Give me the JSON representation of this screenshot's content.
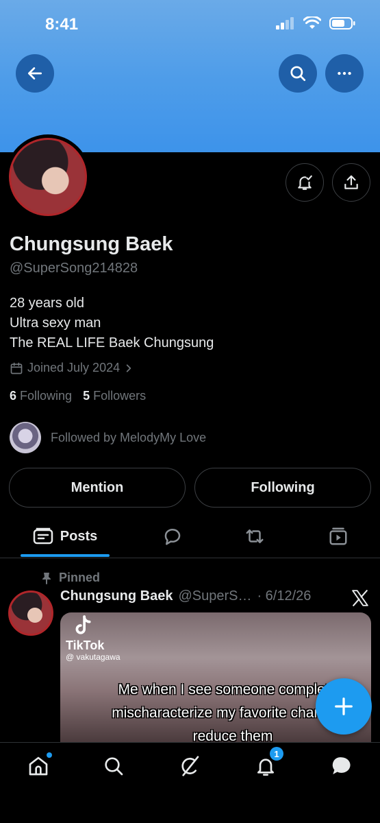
{
  "status_bar": {
    "time": "8:41"
  },
  "profile": {
    "name": "Chungsung Baek",
    "handle": "@SuperSong214828",
    "bio": [
      "28 years old",
      "Ultra sexy man",
      "The REAL LIFE Baek Chungsung"
    ],
    "joined": "Joined July 2024",
    "following_count": "6",
    "following_label": "Following",
    "followers_count": "5",
    "followers_label": "Followers",
    "followed_by": "Followed by MelodyMy Love"
  },
  "actions": {
    "mention_label": "Mention",
    "following_label": "Following"
  },
  "tabs": {
    "posts_label": "Posts"
  },
  "post": {
    "pinned_label": "Pinned",
    "author_name": "Chungsung Baek",
    "author_handle": "@SuperS…",
    "date": "· 6/12/26",
    "media": {
      "tiktok_logo": "TikTok",
      "tiktok_user": "@ vakutagawa",
      "caption": "Me when I see someone completely mischaracterize my favorite character, reduce them"
    }
  },
  "nav": {
    "notifications_badge": "1"
  },
  "colors": {
    "accent": "#1d9bf0",
    "banner": "#4f9de9",
    "background": "#000000",
    "muted": "#71767b"
  }
}
